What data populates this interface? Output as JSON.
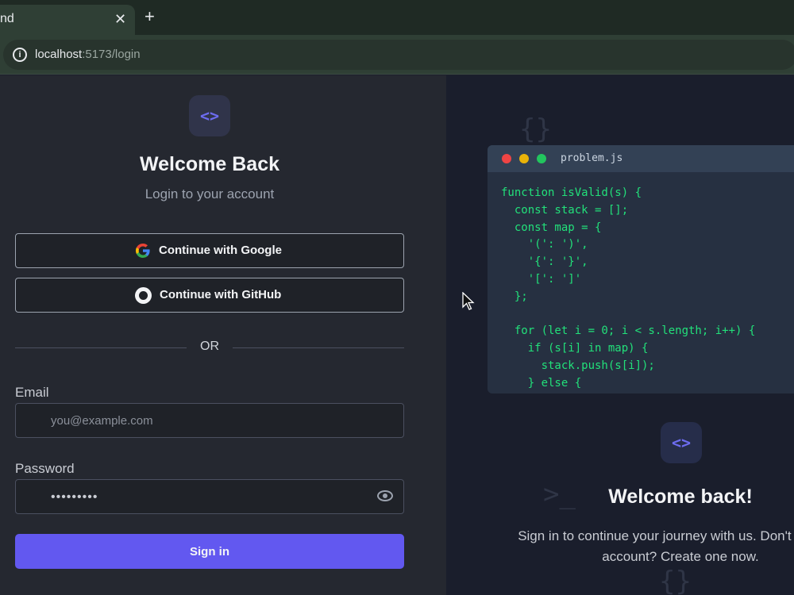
{
  "browser": {
    "tab_title": "nd",
    "tab_close": "✕",
    "new_tab": "+",
    "url_host": "localhost",
    "url_path": ":5173/login"
  },
  "login": {
    "title": "Welcome Back",
    "subtitle": "Login to your account",
    "google_label": "Continue with Google",
    "github_label": "Continue with GitHub",
    "or_label": "OR",
    "email_label": "Email",
    "email_placeholder": "you@example.com",
    "password_label": "Password",
    "password_value": "•••••••••",
    "signin_label": "Sign in"
  },
  "promo": {
    "code_file": "problem.js",
    "code": "function isValid(s) {\n  const stack = [];\n  const map = {\n    '(': ')',\n    '{': '}',\n    '[': ']'\n  };\n\n  for (let i = 0; i < s.length; i++) {\n    if (s[i] in map) {\n      stack.push(s[i]);\n    } else {",
    "title": "Welcome back!",
    "text": "Sign in to continue your journey with us. Don't have an account? Create one now.",
    "deco_braces": "{}",
    "deco_prompt": ">_"
  },
  "logo_glyph": "<>",
  "colors": {
    "accent": "#6258f0",
    "code_green": "#22e07a",
    "dot_red": "#ef4444",
    "dot_yellow": "#eab308",
    "dot_green": "#22c55e"
  }
}
